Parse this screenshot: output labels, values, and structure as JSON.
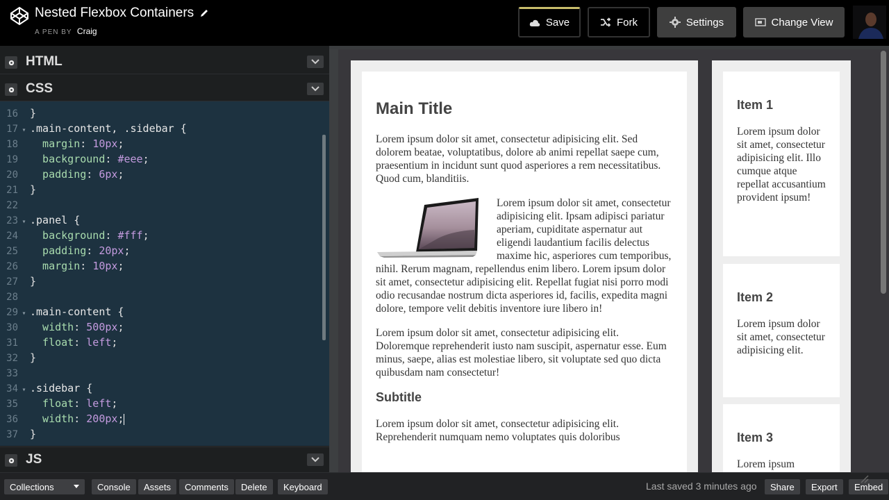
{
  "header": {
    "pen_title": "Nested Flexbox Containers",
    "pen_by_prefix": "A PEN BY",
    "author": "Craig",
    "buttons": {
      "save": "Save",
      "fork": "Fork",
      "settings": "Settings",
      "change_view": "Change View"
    }
  },
  "editors": {
    "html_label": "HTML",
    "css_label": "CSS",
    "js_label": "JS"
  },
  "css_code": [
    {
      "n": "16",
      "fold": "",
      "parts": [
        {
          "t": "}",
          "c": "code"
        }
      ]
    },
    {
      "n": "17",
      "fold": "▾",
      "parts": [
        {
          "t": ".main-content, .sidebar {",
          "c": "sel"
        }
      ]
    },
    {
      "n": "18",
      "fold": "",
      "parts": [
        {
          "t": "  margin",
          "c": "prop"
        },
        {
          "t": ": ",
          "c": "code"
        },
        {
          "t": "10px",
          "c": "val"
        },
        {
          "t": ";",
          "c": "code"
        }
      ]
    },
    {
      "n": "19",
      "fold": "",
      "parts": [
        {
          "t": "  background",
          "c": "prop"
        },
        {
          "t": ": ",
          "c": "code"
        },
        {
          "t": "#eee",
          "c": "val"
        },
        {
          "t": ";",
          "c": "code"
        }
      ]
    },
    {
      "n": "20",
      "fold": "",
      "parts": [
        {
          "t": "  padding",
          "c": "prop"
        },
        {
          "t": ": ",
          "c": "code"
        },
        {
          "t": "6px",
          "c": "val"
        },
        {
          "t": ";",
          "c": "code"
        }
      ]
    },
    {
      "n": "21",
      "fold": "",
      "parts": [
        {
          "t": "}",
          "c": "code"
        }
      ]
    },
    {
      "n": "22",
      "fold": "",
      "parts": []
    },
    {
      "n": "23",
      "fold": "▾",
      "parts": [
        {
          "t": ".panel {",
          "c": "sel"
        }
      ]
    },
    {
      "n": "24",
      "fold": "",
      "parts": [
        {
          "t": "  background",
          "c": "prop"
        },
        {
          "t": ": ",
          "c": "code"
        },
        {
          "t": "#fff",
          "c": "val"
        },
        {
          "t": ";",
          "c": "code"
        }
      ]
    },
    {
      "n": "25",
      "fold": "",
      "parts": [
        {
          "t": "  padding",
          "c": "prop"
        },
        {
          "t": ": ",
          "c": "code"
        },
        {
          "t": "20px",
          "c": "val"
        },
        {
          "t": ";",
          "c": "code"
        }
      ]
    },
    {
      "n": "26",
      "fold": "",
      "parts": [
        {
          "t": "  margin",
          "c": "prop"
        },
        {
          "t": ": ",
          "c": "code"
        },
        {
          "t": "10px",
          "c": "val"
        },
        {
          "t": ";",
          "c": "code"
        }
      ]
    },
    {
      "n": "27",
      "fold": "",
      "parts": [
        {
          "t": "}",
          "c": "code"
        }
      ]
    },
    {
      "n": "28",
      "fold": "",
      "parts": []
    },
    {
      "n": "29",
      "fold": "▾",
      "parts": [
        {
          "t": ".main-content {",
          "c": "sel"
        }
      ]
    },
    {
      "n": "30",
      "fold": "",
      "parts": [
        {
          "t": "  width",
          "c": "prop"
        },
        {
          "t": ": ",
          "c": "code"
        },
        {
          "t": "500px",
          "c": "val"
        },
        {
          "t": ";",
          "c": "code"
        }
      ]
    },
    {
      "n": "31",
      "fold": "",
      "parts": [
        {
          "t": "  float",
          "c": "prop"
        },
        {
          "t": ": ",
          "c": "code"
        },
        {
          "t": "left",
          "c": "val"
        },
        {
          "t": ";",
          "c": "code"
        }
      ]
    },
    {
      "n": "32",
      "fold": "",
      "parts": [
        {
          "t": "}",
          "c": "code"
        }
      ]
    },
    {
      "n": "33",
      "fold": "",
      "parts": []
    },
    {
      "n": "34",
      "fold": "▾",
      "parts": [
        {
          "t": ".sidebar {",
          "c": "sel"
        }
      ]
    },
    {
      "n": "35",
      "fold": "",
      "parts": [
        {
          "t": "  float",
          "c": "prop"
        },
        {
          "t": ": ",
          "c": "code"
        },
        {
          "t": "left",
          "c": "val"
        },
        {
          "t": ";",
          "c": "code"
        }
      ]
    },
    {
      "n": "36",
      "fold": "",
      "parts": [
        {
          "t": "  width",
          "c": "prop"
        },
        {
          "t": ": ",
          "c": "code"
        },
        {
          "t": "200px",
          "c": "val"
        },
        {
          "t": ";",
          "c": "code"
        }
      ],
      "cursor": true
    },
    {
      "n": "37",
      "fold": "",
      "parts": [
        {
          "t": "}",
          "c": "code"
        }
      ]
    }
  ],
  "preview": {
    "main_title": "Main Title",
    "para1": "Lorem ipsum dolor sit amet, consectetur adipisicing elit. Sed dolorem beatae, voluptatibus, dolore ab animi repellat saepe cum, praesentium in incidunt sunt quod asperiores a rem necessitatibus. Quod cum, blanditiis.",
    "para2": "Lorem ipsum dolor sit amet, consectetur adipisicing elit. Ipsam adipisci pariatur aperiam, cupiditate aspernatur aut eligendi laudantium facilis delectus maxime hic, asperiores cum temporibus, nihil. Rerum magnam, repellendus enim libero. Lorem ipsum dolor sit amet, consectetur adipisicing elit. Repellat fugiat nisi porro modi odio recusandae nostrum dicta asperiores id, facilis, expedita magni dolore, tempore velit debitis inventore iure libero in!",
    "para3": "Lorem ipsum dolor sit amet, consectetur adipisicing elit. Doloremque reprehenderit iusto nam suscipit, aspernatur esse. Eum minus, saepe, alias est molestiae libero, sit voluptate sed quo dicta quibusdam nam consectetur!",
    "subtitle": "Subtitle",
    "para4": "Lorem ipsum dolor sit amet, consectetur adipisicing elit. Reprehenderit numquam nemo voluptates quis doloribus",
    "items": [
      {
        "title": "Item 1",
        "text": "Lorem ipsum dolor sit amet, consectetur adipisicing elit. Illo cumque atque repellat accusantium provident ipsum!"
      },
      {
        "title": "Item 2",
        "text": "Lorem ipsum dolor sit amet, consectetur adipisicing elit."
      },
      {
        "title": "Item 3",
        "text": "Lorem ipsum"
      }
    ]
  },
  "footer": {
    "collections": "Collections",
    "console": "Console",
    "assets": "Assets",
    "comments": "Comments",
    "delete": "Delete",
    "keyboard": "Keyboard",
    "last_saved": "Last saved 3 minutes ago",
    "share": "Share",
    "export": "Export",
    "embed": "Embed"
  }
}
